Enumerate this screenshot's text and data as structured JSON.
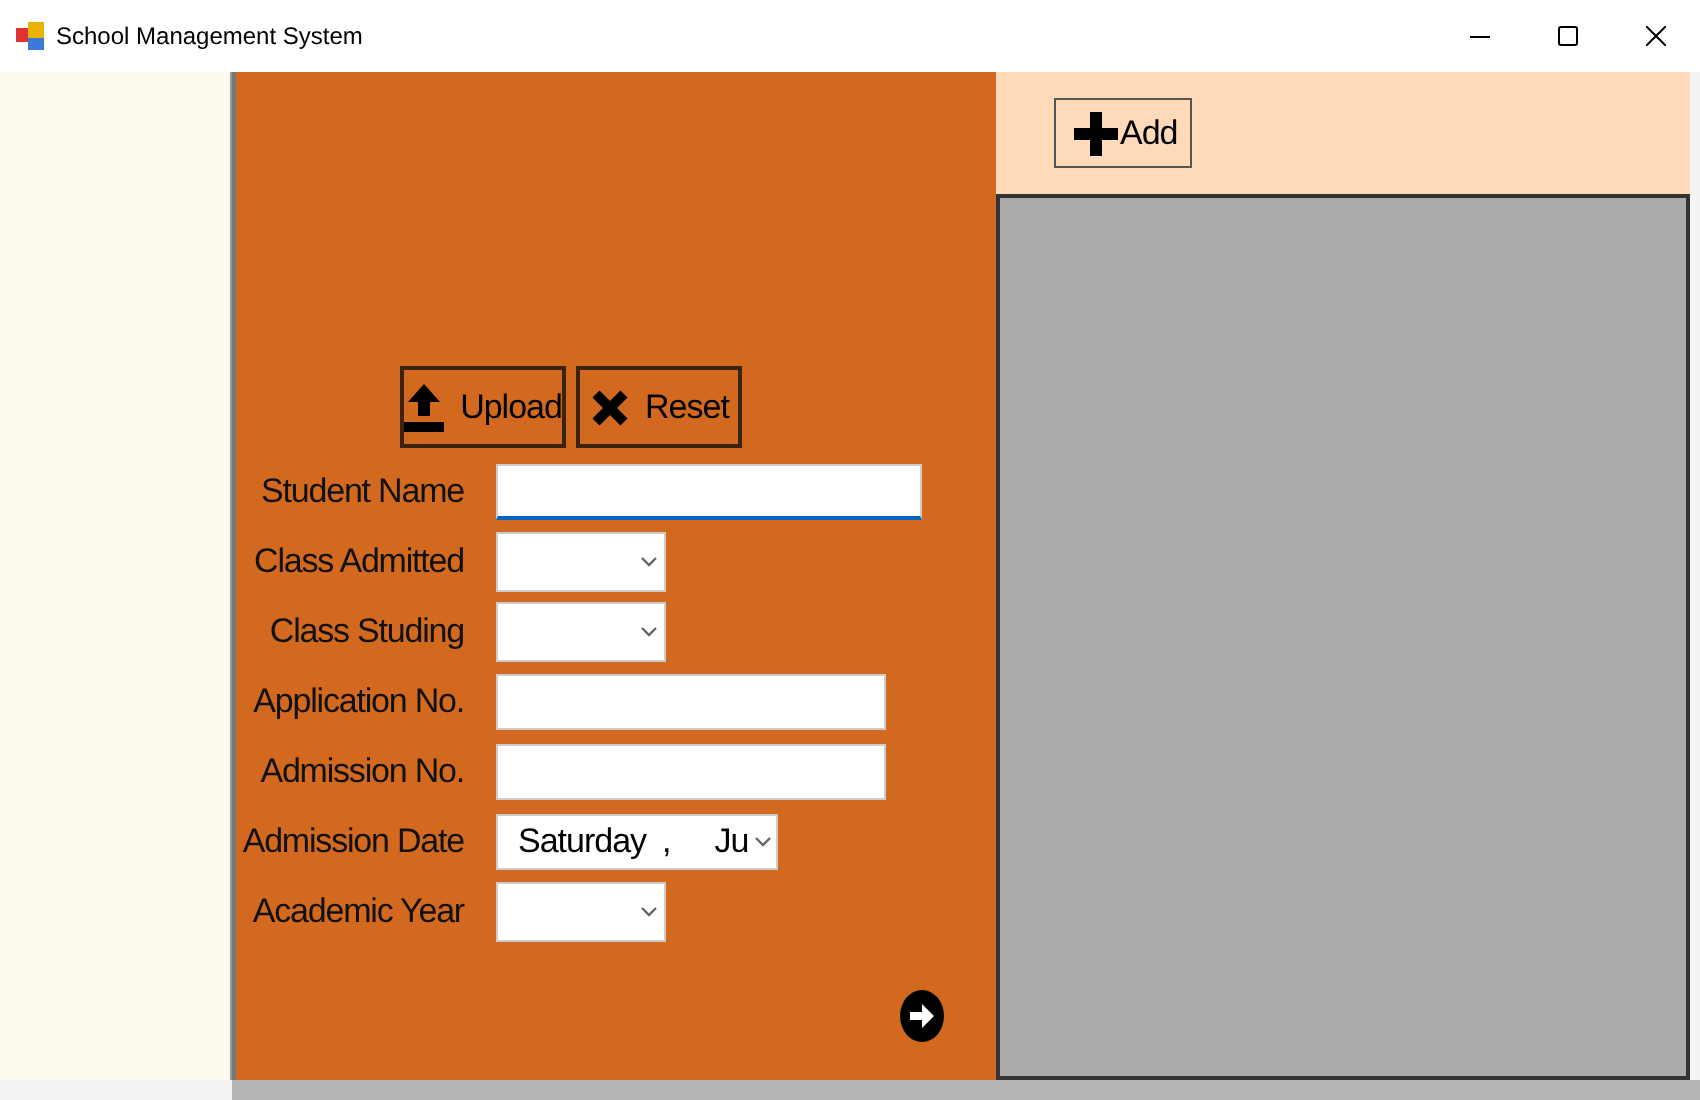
{
  "window": {
    "title": "School Management System"
  },
  "toolbar": {
    "buttons": [
      {
        "label": "Upload",
        "kind": "upload"
      },
      {
        "label": "Reset",
        "kind": "reset"
      }
    ]
  },
  "form": {
    "fields": [
      {
        "label": "Student Name",
        "kind": "text",
        "focused": true
      },
      {
        "label": "Class Admitted",
        "kind": "combo"
      },
      {
        "label": "Class Studing",
        "kind": "combo"
      },
      {
        "label": "Application No.",
        "kind": "text",
        "focused": false
      },
      {
        "label": "Admission No.",
        "kind": "text",
        "focused": false
      },
      {
        "label": "Admission Date",
        "kind": "date",
        "day": "Saturday",
        "separator": ",",
        "month": "Ju"
      },
      {
        "label": "Academic Year",
        "kind": "combo"
      }
    ]
  },
  "side_panel": {
    "add_button": {
      "label": "Add"
    }
  }
}
